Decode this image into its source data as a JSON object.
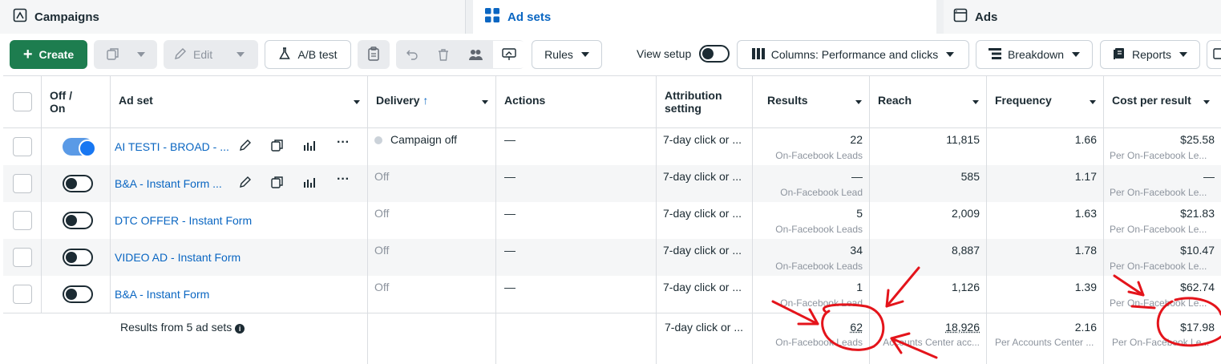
{
  "tabs": [
    {
      "label": "Campaigns",
      "icon": "campaign-folder-icon"
    },
    {
      "label": "Ad sets",
      "icon": "grid-icon"
    },
    {
      "label": "Ads",
      "icon": "ad-window-icon"
    }
  ],
  "toolbar": {
    "create_label": "Create",
    "edit_label": "Edit",
    "ab_test_label": "A/B test",
    "rules_label": "Rules",
    "view_setup_label": "View setup",
    "columns_label": "Columns: Performance and clicks",
    "breakdown_label": "Breakdown",
    "reports_label": "Reports"
  },
  "table": {
    "headers": {
      "off_on": "Off / On",
      "ad_set": "Ad set",
      "delivery": "Delivery",
      "actions": "Actions",
      "attribution": "Attribution setting",
      "results": "Results",
      "reach": "Reach",
      "frequency": "Frequency",
      "cost_per_result": "Cost per result"
    },
    "rows": [
      {
        "name": "AI TESTI - BROAD - ...",
        "on": true,
        "delivery": "Campaign off",
        "actions": "—",
        "attribution": "7-day click or ...",
        "results": "22",
        "results_sub": "On-Facebook Leads",
        "reach": "11,815",
        "frequency": "1.66",
        "cost": "$25.58",
        "cost_sub": "Per On-Facebook Le..."
      },
      {
        "name": "B&A - Instant Form ...",
        "on": false,
        "delivery": "Off",
        "actions": "—",
        "attribution": "7-day click or ...",
        "results": "—",
        "results_sub": "On-Facebook Lead",
        "reach": "585",
        "frequency": "1.17",
        "cost": "—",
        "cost_sub": "Per On-Facebook Le..."
      },
      {
        "name": "DTC OFFER - Instant Form",
        "on": false,
        "delivery": "Off",
        "actions": "—",
        "attribution": "7-day click or ...",
        "results": "5",
        "results_sub": "On-Facebook Leads",
        "reach": "2,009",
        "frequency": "1.63",
        "cost": "$21.83",
        "cost_sub": "Per On-Facebook Le..."
      },
      {
        "name": "VIDEO AD - Instant Form",
        "on": false,
        "delivery": "Off",
        "actions": "—",
        "attribution": "7-day click or ...",
        "results": "34",
        "results_sub": "On-Facebook Leads",
        "reach": "8,887",
        "frequency": "1.78",
        "cost": "$10.47",
        "cost_sub": "Per On-Facebook Le..."
      },
      {
        "name": "B&A - Instant Form",
        "on": false,
        "delivery": "Off",
        "actions": "—",
        "attribution": "7-day click or ...",
        "results": "1",
        "results_sub": "On-Facebook Lead",
        "reach": "1,126",
        "frequency": "1.39",
        "cost": "$62.74",
        "cost_sub": "Per On-Facebook Le..."
      }
    ],
    "footer": {
      "label": "Results from 5 ad sets",
      "attribution": "7-day click or ...",
      "results": "62",
      "results_sub": "On-Facebook Leads",
      "reach": "18,926",
      "reach_sub": "Accounts Center acc...",
      "frequency": "2.16",
      "frequency_sub": "Per Accounts Center ...",
      "cost": "$17.98",
      "cost_sub": "Per On-Facebook Le..."
    }
  },
  "colors": {
    "accent": "#0a66c2",
    "create": "#1d7d4f",
    "annotation": "#e4141b"
  }
}
